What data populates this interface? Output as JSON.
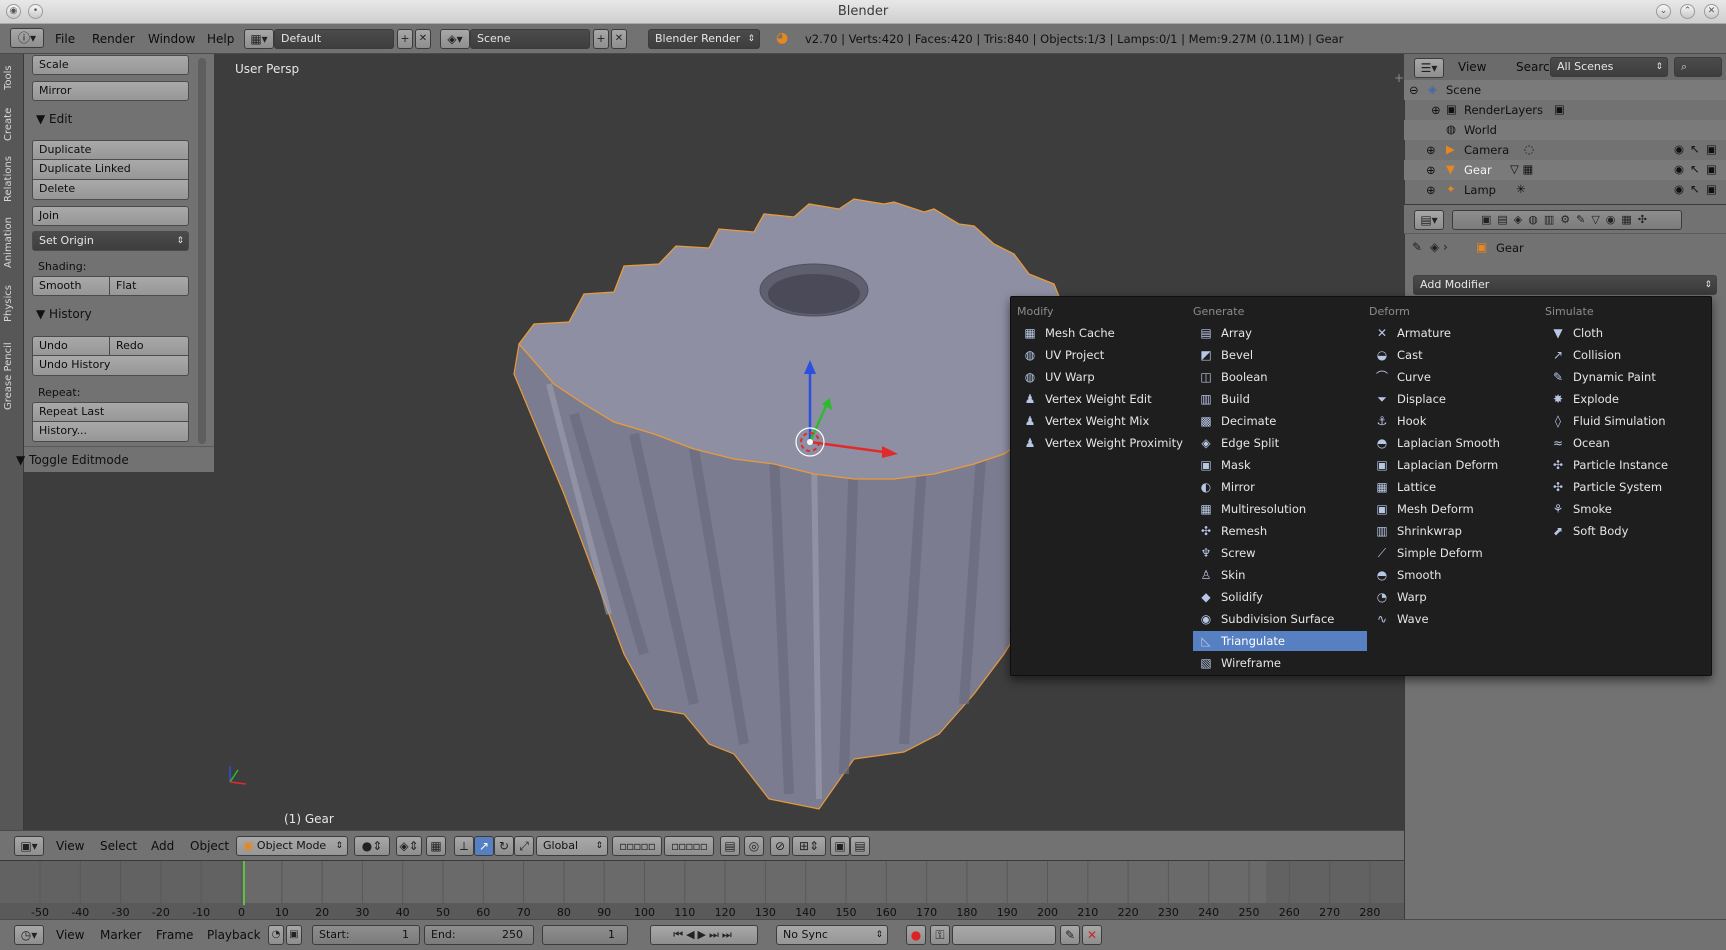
{
  "window": {
    "title": "Blender"
  },
  "info_header": {
    "menus": [
      "File",
      "Render",
      "Window",
      "Help"
    ],
    "layout": "Default",
    "scene": "Scene",
    "engine": "Blender Render",
    "stats": "v2.70 | Verts:420 | Faces:420 | Tris:840 | Objects:1/3 | Lamps:0/1 | Mem:9.27M (0.11M) | Gear"
  },
  "tool_tabs": [
    "Tools",
    "Create",
    "Relations",
    "Animation",
    "Physics",
    "Grease Pencil"
  ],
  "tool_shelf": {
    "top_buttons": [
      "Scale",
      "Mirror"
    ],
    "edit_panel": "Edit",
    "edit_buttons": [
      "Duplicate",
      "Duplicate Linked",
      "Delete"
    ],
    "join": "Join",
    "set_origin": "Set Origin",
    "shading_label": "Shading:",
    "shading_buttons": [
      "Smooth",
      "Flat"
    ],
    "history_panel": "History",
    "undo": "Undo",
    "redo": "Redo",
    "undo_history": "Undo History",
    "repeat_label": "Repeat:",
    "repeat_last": "Repeat Last",
    "history_dots": "History...",
    "toggle_editmode": "Toggle Editmode"
  },
  "viewport": {
    "label": "User Persp",
    "object_label": "(1) Gear"
  },
  "outliner": {
    "menus": [
      "View",
      "Search"
    ],
    "scenes_dropdown": "All Scenes",
    "items": [
      "Scene",
      "RenderLayers",
      "World",
      "Camera",
      "Gear",
      "Lamp"
    ]
  },
  "properties": {
    "object_name": "Gear",
    "add_modifier": "Add Modifier"
  },
  "modifier_menu": {
    "columns": [
      {
        "title": "Modify",
        "items": [
          {
            "label": "Mesh Cache",
            "icon": "▦"
          },
          {
            "label": "UV Project",
            "icon": "◍"
          },
          {
            "label": "UV Warp",
            "icon": "◍"
          },
          {
            "label": "Vertex Weight Edit",
            "icon": "♟"
          },
          {
            "label": "Vertex Weight Mix",
            "icon": "♟"
          },
          {
            "label": "Vertex Weight Proximity",
            "icon": "♟"
          }
        ]
      },
      {
        "title": "Generate",
        "items": [
          {
            "label": "Array",
            "icon": "▤"
          },
          {
            "label": "Bevel",
            "icon": "◩"
          },
          {
            "label": "Boolean",
            "icon": "◫"
          },
          {
            "label": "Build",
            "icon": "▥"
          },
          {
            "label": "Decimate",
            "icon": "▩"
          },
          {
            "label": "Edge Split",
            "icon": "◈"
          },
          {
            "label": "Mask",
            "icon": "▣"
          },
          {
            "label": "Mirror",
            "icon": "◐"
          },
          {
            "label": "Multiresolution",
            "icon": "▦"
          },
          {
            "label": "Remesh",
            "icon": "✣"
          },
          {
            "label": "Screw",
            "icon": "♆"
          },
          {
            "label": "Skin",
            "icon": "♙"
          },
          {
            "label": "Solidify",
            "icon": "◆"
          },
          {
            "label": "Subdivision Surface",
            "icon": "◉"
          },
          {
            "label": "Triangulate",
            "icon": "◺",
            "active": true
          },
          {
            "label": "Wireframe",
            "icon": "▧"
          }
        ]
      },
      {
        "title": "Deform",
        "items": [
          {
            "label": "Armature",
            "icon": "✕"
          },
          {
            "label": "Cast",
            "icon": "◒"
          },
          {
            "label": "Curve",
            "icon": "⌒"
          },
          {
            "label": "Displace",
            "icon": "⏷"
          },
          {
            "label": "Hook",
            "icon": "⚓"
          },
          {
            "label": "Laplacian Smooth",
            "icon": "◓"
          },
          {
            "label": "Laplacian Deform",
            "icon": "▣"
          },
          {
            "label": "Lattice",
            "icon": "▦"
          },
          {
            "label": "Mesh Deform",
            "icon": "▣"
          },
          {
            "label": "Shrinkwrap",
            "icon": "▥"
          },
          {
            "label": "Simple Deform",
            "icon": "⟋"
          },
          {
            "label": "Smooth",
            "icon": "◓"
          },
          {
            "label": "Warp",
            "icon": "◔"
          },
          {
            "label": "Wave",
            "icon": "∿"
          }
        ]
      },
      {
        "title": "Simulate",
        "items": [
          {
            "label": "Cloth",
            "icon": "▼"
          },
          {
            "label": "Collision",
            "icon": "↗"
          },
          {
            "label": "Dynamic Paint",
            "icon": "✎"
          },
          {
            "label": "Explode",
            "icon": "✸"
          },
          {
            "label": "Fluid Simulation",
            "icon": "◊"
          },
          {
            "label": "Ocean",
            "icon": "≈"
          },
          {
            "label": "Particle Instance",
            "icon": "✣"
          },
          {
            "label": "Particle System",
            "icon": "✣"
          },
          {
            "label": "Smoke",
            "icon": "⚘"
          },
          {
            "label": "Soft Body",
            "icon": "⬈"
          }
        ]
      }
    ]
  },
  "view3d_header": {
    "menus": [
      "View",
      "Select",
      "Add",
      "Object"
    ],
    "mode": "Object Mode",
    "orientation": "Global"
  },
  "timeline": {
    "ticks": [
      "-50",
      "-40",
      "-30",
      "-20",
      "-10",
      "0",
      "10",
      "20",
      "30",
      "40",
      "50",
      "60",
      "70",
      "80",
      "90",
      "100",
      "110",
      "120",
      "130",
      "140",
      "150",
      "160",
      "170",
      "180",
      "190",
      "200",
      "210",
      "220",
      "230",
      "240",
      "250",
      "260",
      "270",
      "280"
    ],
    "current_frame_marker": 0
  },
  "timeline_header": {
    "menus": [
      "View",
      "Marker",
      "Frame",
      "Playback"
    ],
    "start_label": "Start:",
    "start_value": "1",
    "end_label": "End:",
    "end_value": "250",
    "current_frame": "1",
    "sync": "No Sync"
  },
  "colors": {
    "panel": "#727272",
    "viewport": "#3d3d3d",
    "menu_bg": "#1e1e1e",
    "highlight": "#5680c2",
    "gear_fill": "#8f8fa3",
    "selection_outline": "#e89b3a"
  }
}
